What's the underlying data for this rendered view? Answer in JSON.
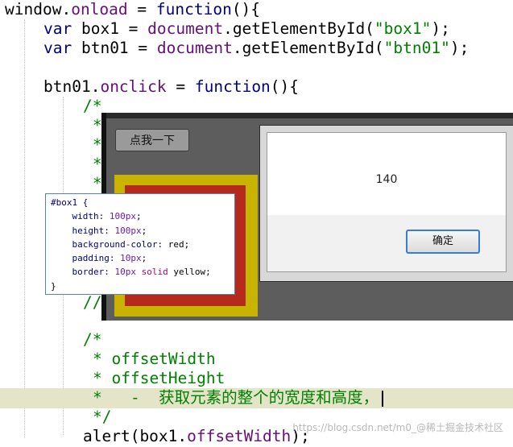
{
  "code": {
    "line1": {
      "a": "window",
      "b": ".",
      "c": "onload",
      "d": " = ",
      "e": "function",
      "f": "(){"
    },
    "line2": {
      "kw": "var",
      "rest1": " box1 = ",
      "obj": "document",
      "rest2": ".getElementById(",
      "str": "\"box1\"",
      "end": ");"
    },
    "line3": {
      "kw": "var",
      "rest1": " btn01 = ",
      "obj": "document",
      "rest2": ".getElementById(",
      "str": "\"btn01\"",
      "end": ");"
    },
    "line5": {
      "a": "btn01.",
      "b": "onclick",
      "c": " = ",
      "d": "function",
      "e": "(){"
    },
    "line6": "/*",
    "line_star": "*",
    "line_slashes": "//",
    "c_open": "/*",
    "c_line1": "* offsetWidth",
    "c_line2": "* offsetHeight",
    "c_line3": "*   -  获取元素的整个的宽度和高度，",
    "c_close": "*/",
    "last": {
      "a": "alert(box1.",
      "b": "offsetWidth",
      "c": ");"
    }
  },
  "browser": {
    "button_label": "点我一下",
    "alert_message": "140",
    "alert_ok": "确定"
  },
  "tooltip": {
    "l1": "#box1 {",
    "l2a": "    width: ",
    "l2b": "100px",
    "l2c": ";",
    "l3a": "    height: ",
    "l3b": "100px",
    "l3c": ";",
    "l4a": "    background-color: ",
    "l4b": "red;",
    "l5a": "    padding: ",
    "l5b": "10px",
    "l5c": ";",
    "l6a": "    border: ",
    "l6b": "10px",
    "l6c": " solid",
    "l6d": " yellow;",
    "l7": "}"
  },
  "watermark": "https://blog.csdn.net/m0_@稀土掘金技术社区"
}
